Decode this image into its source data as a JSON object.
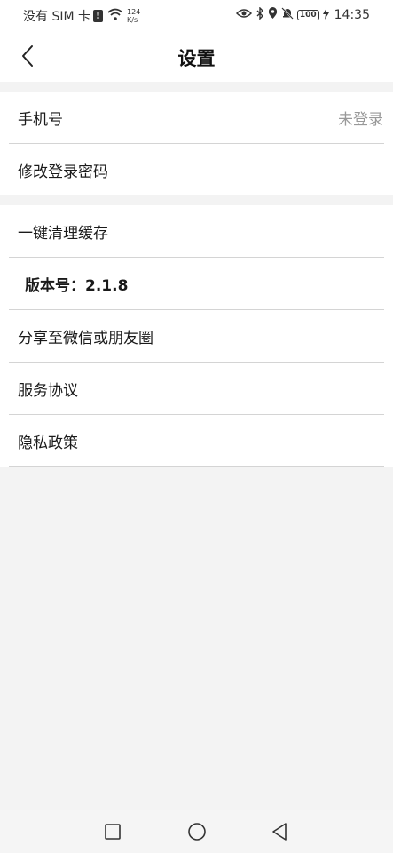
{
  "status_bar": {
    "carrier": "没有 SIM 卡",
    "alert_glyph": "!",
    "speed_value": "124",
    "speed_unit": "K/s",
    "battery": "100",
    "time": "14:35",
    "icons": [
      "eye-icon",
      "bluetooth-icon",
      "location-icon",
      "mute-bell-icon",
      "battery-icon",
      "charging-icon"
    ]
  },
  "header": {
    "title": "设置",
    "back_icon": "chevron-left-icon"
  },
  "account_group": {
    "phone_label": "手机号",
    "phone_value": "未登录",
    "change_password_label": "修改登录密码"
  },
  "misc_group": {
    "clear_cache_label": "一键清理缓存",
    "version_label": "版本号：2.1.8",
    "share_label": "分享至微信或朋友圈",
    "service_agreement_label": "服务协议",
    "privacy_policy_label": "隐私政策"
  },
  "nav_bar": {
    "icons": [
      "square-recents-icon",
      "circle-home-icon",
      "triangle-back-icon"
    ]
  },
  "colors": {
    "background": "#f3f3f3",
    "surface": "#ffffff",
    "muted_text": "#999999",
    "divider": "#d4d4d4"
  }
}
